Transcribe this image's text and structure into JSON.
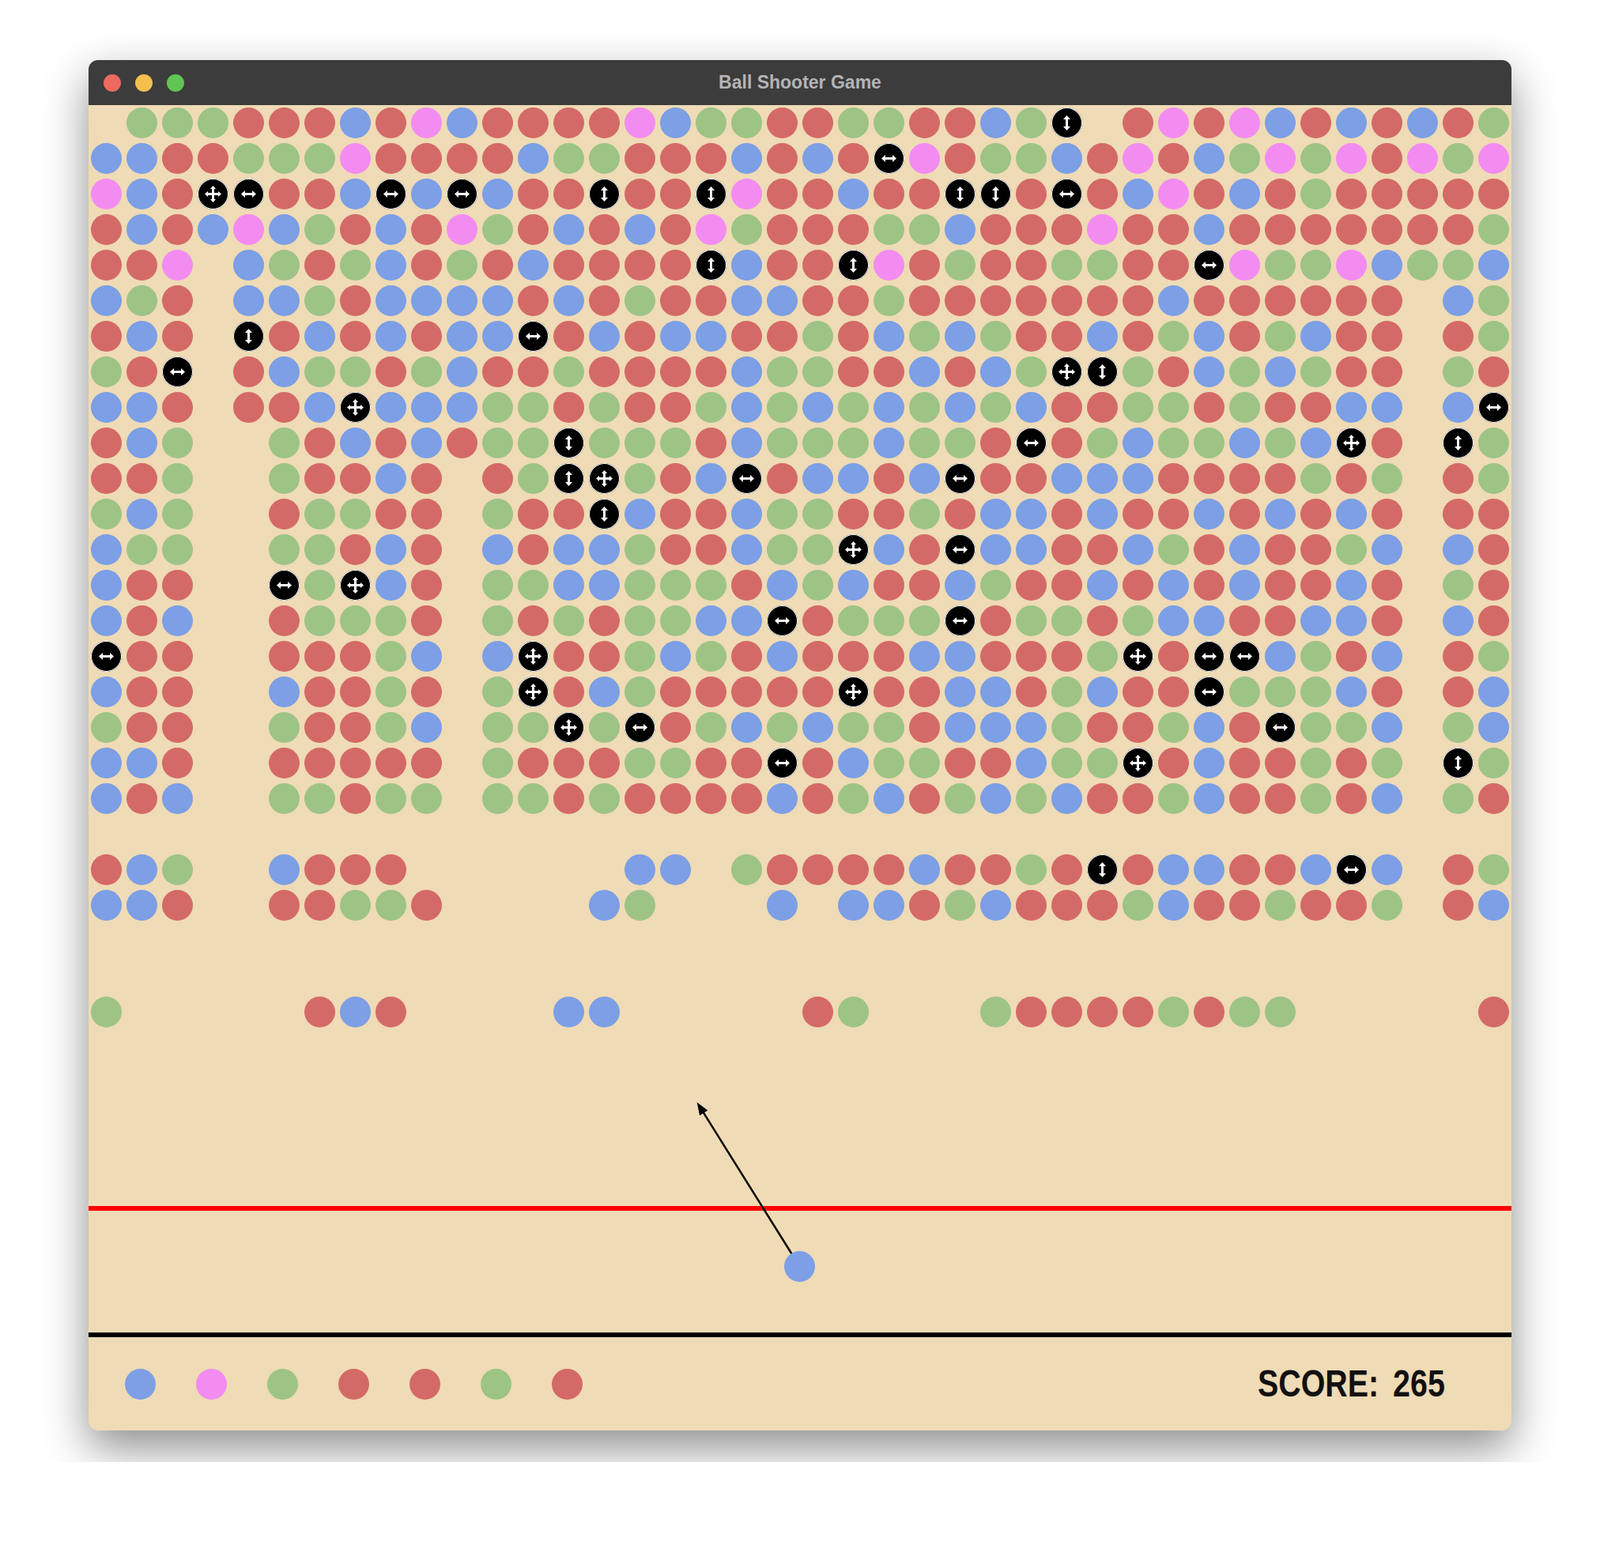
{
  "window": {
    "title": "Ball Shooter Game"
  },
  "board": {
    "palette": {
      "r": "#d46a67",
      "g": "#9dc485",
      "b": "#7c9fe5",
      "p": "#f38cf1"
    },
    "rows": [
      "xgggrrrbrpbrrrrpbggrrggrrbgvxrprpbrbrbrg",
      "bbrrgggprrrrbggrrrbrbrhprggbrprbgpgprpgp",
      "pbrmhrrbhbhbrrvrrvprrbrrvvrhrbprbrgrrrrr",
      "rbrbpbgrbrpgrbrbrpgrrrggbrrrprrbrrrrrrrg",
      "rrpxbgrgbrgrbrrrrvbrrvprgrrggrrhpggpbggb",
      "bgrxbbgrbbbbrbrgrrbbrrgrrrrrrrbrrrrrrxbg",
      "rbrxvrbrbrbbhrbrbbrrgrbgbgrrbrgbrgbrrxrg",
      "grhxrbggrgbrrgrrrrbggrrbrbgmvgrbgbgrrxgr",
      "bbrxrrbmbbbggrgrrgbgbgbgbgbrrggrgrrbbxbh",
      "rbgxxgrbrbrggvgggrbgggbggrhrgbggbgbmrxvg",
      "rrgxxgrrbrxrgvmgrbhrbbrbhrrbbbrrrrgrgxrg",
      "gbgxxrggrrxgrrvbrrbggrrgrbbrbrrbrbrbrxrr",
      "bggxxggrbrxbrbbgrrbggmbrhbbrrbgrbrrgbxbr",
      "brrxxhgmbrxggbbgggrbgbrrbgrrbrbrbrrbrxgr",
      "brbxxrgggrxgrgrggbbhrggghrggrgbbrrbbrxbr",
      "hrrxxrrrgbxbmrrgbgrbrrrbbrrrgmrhhbgrbxrg",
      "brrxxbrrgrxgmrbgrrrrrmrrbbrgbrrhgggbrxrb",
      "grrxxgrrgbxggmghrgbgbggrbbbgrrgbrhggbxgb",
      "bbrxxrrrrrxgrrrggrrhrbggrrbggmrbrrgrgxvg",
      "brbxxggrggxggrgrrrrbrgbrgbgbrrgbrrgrbxgr",
      "xxxxxxxxxxxxxxxxxxxxxxxxxxxxxxxxxxxxxxxx",
      "rbgxxbrrrxxxxxxbbxgrrrrbrrgrvrbbrrbhbxrg",
      "bbrxxrrggrxxxxbgxxxbxbbrgbrrrgbrrgrrgxrb",
      "xxxxxxxxxxxxxxxxxxxxxxxxxxxxxxxxxxxxxxxx",
      "xxxxxxxxxxxxxxxxxxxxxxxxxxxxxxxxxxxxxxxx",
      "gxxxxxrbrxxxxbbxxxxxrgxxxgrrrrgrggxxxxxr"
    ]
  },
  "shooter": {
    "color": "#7c9fe5",
    "aim_degrees": -32
  },
  "queue": [
    {
      "color": "#7c9fe5"
    },
    {
      "color": "#f38cf1"
    },
    {
      "color": "#9dc485"
    },
    {
      "color": "#d46a67"
    },
    {
      "color": "#d46a67"
    },
    {
      "color": "#9dc485"
    },
    {
      "color": "#d46a67"
    }
  ],
  "score": {
    "label": "SCORE:",
    "value": "265"
  }
}
